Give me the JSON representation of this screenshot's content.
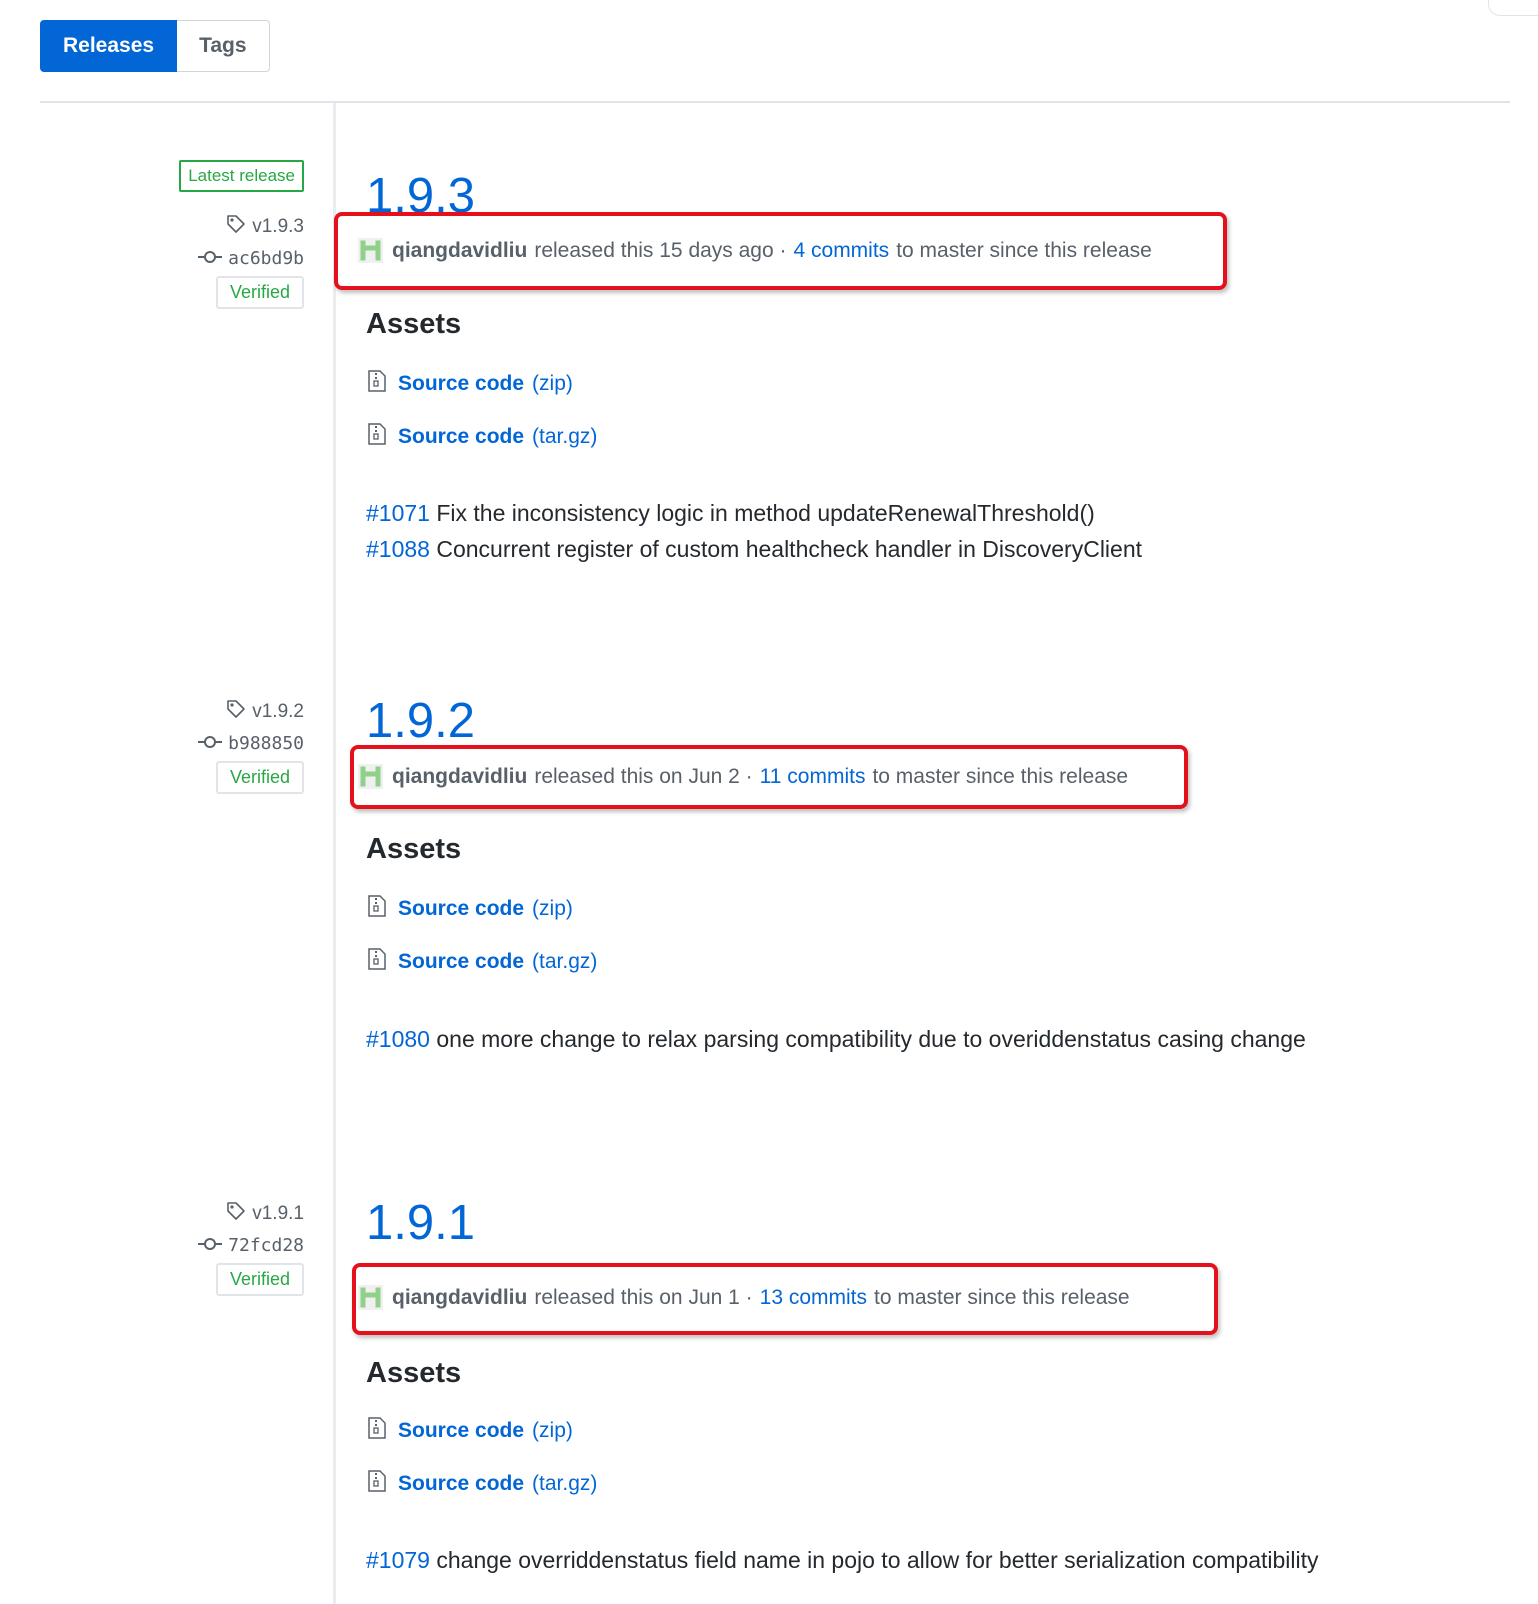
{
  "tabs": {
    "releases": "Releases",
    "tags": "Tags"
  },
  "releases": [
    {
      "latest_badge": "Latest release",
      "tag": "v1.9.3",
      "commit": "ac6bd9b",
      "verified": "Verified",
      "version": "1.9.3",
      "author": "qiangdavidliu",
      "released_text": "released this 15 days ago ·",
      "commits_link": "4 commits",
      "commits_suffix": "to master since this release",
      "assets_title": "Assets",
      "assets": [
        {
          "name": "Source code",
          "ext": "(zip)"
        },
        {
          "name": "Source code",
          "ext": "(tar.gz)"
        }
      ],
      "notes": [
        {
          "ref": "#1071",
          "text": " Fix the inconsistency logic in method updateRenewalThreshold()"
        },
        {
          "ref": "#1088",
          "text": " Concurrent register of custom healthcheck handler in DiscoveryClient"
        }
      ]
    },
    {
      "tag": "v1.9.2",
      "commit": "b988850",
      "verified": "Verified",
      "version": "1.9.2",
      "author": "qiangdavidliu",
      "released_text": "released this on Jun 2 ·",
      "commits_link": "11 commits",
      "commits_suffix": "to master since this release",
      "assets_title": "Assets",
      "assets": [
        {
          "name": "Source code",
          "ext": "(zip)"
        },
        {
          "name": "Source code",
          "ext": "(tar.gz)"
        }
      ],
      "notes": [
        {
          "ref": "#1080",
          "text": " one more change to relax parsing compatibility due to overiddenstatus casing change"
        }
      ]
    },
    {
      "tag": "v1.9.1",
      "commit": "72fcd28",
      "verified": "Verified",
      "version": "1.9.1",
      "author": "qiangdavidliu",
      "released_text": "released this on Jun 1 ·",
      "commits_link": "13 commits",
      "commits_suffix": "to master since this release",
      "assets_title": "Assets",
      "assets": [
        {
          "name": "Source code",
          "ext": "(zip)"
        },
        {
          "name": "Source code",
          "ext": "(tar.gz)"
        }
      ],
      "notes": [
        {
          "ref": "#1079",
          "text": " change overriddenstatus field name in pojo to allow for better serialization compatibility"
        }
      ]
    }
  ],
  "colors": {
    "link": "#0366d6",
    "verified": "#28a745",
    "highlight": "#e4111c",
    "tab_active": "#0366d6"
  },
  "icons": {
    "tag": "tag-icon",
    "commit": "commit-icon",
    "archive": "file-zip-icon",
    "avatar": "identicon-avatar"
  }
}
